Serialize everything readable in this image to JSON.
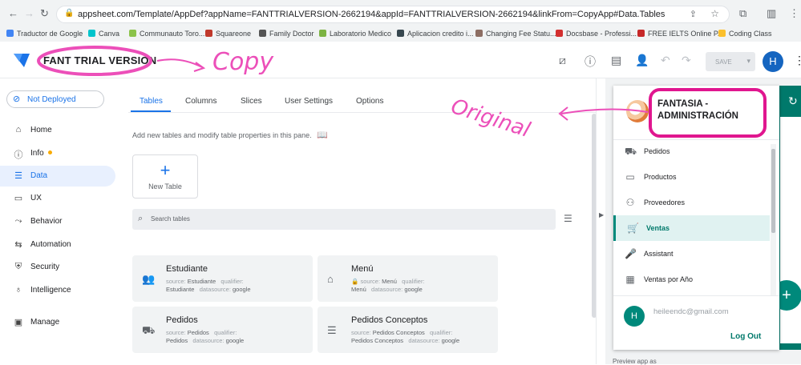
{
  "browser": {
    "url": "appsheet.com/Template/AppDef?appName=FANTTRIALVERSION-2662194&appId=FANTTRIALVERSION-2662194&linkFrom=CopyApp#Data.Tables",
    "bookmarks": [
      {
        "label": "Traductor de Google",
        "color": "#4285f4"
      },
      {
        "label": "Canva",
        "color": "#00c4cc"
      },
      {
        "label": "Communauto Toro...",
        "color": "#8bc34a"
      },
      {
        "label": "Squareone",
        "color": "#c0392b"
      },
      {
        "label": "Family Doctor",
        "color": "#555555"
      },
      {
        "label": "Laboratorio Medico",
        "color": "#7cb342"
      },
      {
        "label": "Aplicacion credito i...",
        "color": "#37474f"
      },
      {
        "label": "Changing Fee Statu...",
        "color": "#8d6e63"
      },
      {
        "label": "Docsbase - Professi...",
        "color": "#d32f2f"
      },
      {
        "label": "FREE IELTS Online P...",
        "color": "#c62828"
      },
      {
        "label": "Coding Class",
        "color": "#fbc02d"
      }
    ]
  },
  "header": {
    "app_name": "FANT TRIAL VERSION",
    "save_label": "SAVE",
    "user_initial": "H"
  },
  "sidebar": {
    "deploy_status": "Not Deployed",
    "items": [
      {
        "label": "Home",
        "icon": "home-icon"
      },
      {
        "label": "Info",
        "icon": "info-icon"
      },
      {
        "label": "Data",
        "icon": "data-icon"
      },
      {
        "label": "UX",
        "icon": "ux-icon"
      },
      {
        "label": "Behavior",
        "icon": "behavior-icon"
      },
      {
        "label": "Automation",
        "icon": "automation-icon"
      },
      {
        "label": "Security",
        "icon": "security-icon"
      },
      {
        "label": "Intelligence",
        "icon": "intelligence-icon"
      },
      {
        "label": "Manage",
        "icon": "manage-icon"
      }
    ],
    "active": "Data"
  },
  "main": {
    "tabs": [
      "Tables",
      "Columns",
      "Slices",
      "User Settings",
      "Options"
    ],
    "active_tab": "Tables",
    "description": "Add new tables and modify table properties in this pane.",
    "new_table_label": "New Table",
    "search_placeholder": "Search tables",
    "tables": [
      {
        "name": "Estudiante",
        "source_label": "source:",
        "source": "Estudiante",
        "qualifier_label": "qualifier:",
        "qualifier": "Estudiante",
        "datasource_label": "datasource:",
        "datasource": "google",
        "icon": "people-icon"
      },
      {
        "name": "Menú",
        "source_label": "source:",
        "source": "Menú",
        "qualifier_label": "qualifier:",
        "qualifier": "Menú",
        "datasource_label": "datasource:",
        "datasource": "google",
        "icon": "bank-icon"
      },
      {
        "name": "Pedidos",
        "source_label": "source:",
        "source": "Pedidos",
        "qualifier_label": "qualifier:",
        "qualifier": "Pedidos",
        "datasource_label": "datasource:",
        "datasource": "google",
        "icon": "truck-icon"
      },
      {
        "name": "Pedidos Conceptos",
        "source_label": "source:",
        "source": "Pedidos Conceptos",
        "qualifier_label": "qualifier:",
        "qualifier": "Pedidos Conceptos",
        "datasource_label": "datasource:",
        "datasource": "google",
        "icon": "list-icon"
      }
    ]
  },
  "preview": {
    "app_title": "FANTASIA - ADMINISTRACIÓN",
    "menu": [
      {
        "label": "Pedidos",
        "icon": "truck-icon"
      },
      {
        "label": "Productos",
        "icon": "products-icon"
      },
      {
        "label": "Proveedores",
        "icon": "suppliers-icon"
      },
      {
        "label": "Ventas",
        "icon": "cart-icon"
      },
      {
        "label": "Assistant",
        "icon": "mic-icon"
      },
      {
        "label": "Ventas por Año",
        "icon": "calendar-icon"
      }
    ],
    "active_menu": "Ventas",
    "user_initial": "H",
    "user_email": "heileendc@gmail.com",
    "logout_label": "Log Out",
    "footer": "Preview app as"
  },
  "annotations": {
    "copy": "Copy",
    "original": "Original"
  },
  "colors": {
    "accent": "#1a73e8",
    "preview_primary": "#00796b",
    "annotation": "#ec4fb9"
  }
}
